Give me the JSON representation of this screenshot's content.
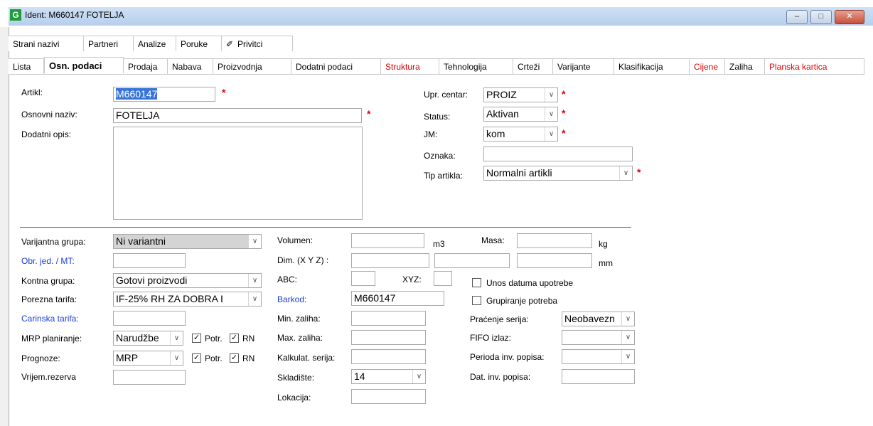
{
  "window": {
    "title": "Ident: M660147 FOTELJA",
    "app_icon": "G",
    "minimize": "–",
    "maximize": "□",
    "close": "✕"
  },
  "toptabs": [
    "Strani nazivi",
    "Partneri",
    "Analize",
    "Poruke",
    "Privitci"
  ],
  "tabs": [
    {
      "label": "Lista"
    },
    {
      "label": "Osn. podaci"
    },
    {
      "label": "Prodaja"
    },
    {
      "label": "Nabava"
    },
    {
      "label": "Proizvodnja"
    },
    {
      "label": "Dodatni podaci"
    },
    {
      "label": "Struktura"
    },
    {
      "label": "Tehnologija"
    },
    {
      "label": "Crteži"
    },
    {
      "label": "Varijante"
    },
    {
      "label": "Klasifikacija"
    },
    {
      "label": "Cijene"
    },
    {
      "label": "Zaliha"
    },
    {
      "label": "Planska kartica"
    }
  ],
  "top": {
    "artikl_label": "Artikl:",
    "artikl_value": "M660147",
    "naziv_label": "Osnovni naziv:",
    "naziv_value": "FOTELJA",
    "opis_label": "Dodatni opis:",
    "opis_value": "",
    "upr_label": "Upr. centar:",
    "upr_value": "PROIZ",
    "status_label": "Status:",
    "status_value": "Aktivan",
    "jm_label": "JM:",
    "jm_value": "kom",
    "oznaka_label": "Oznaka:",
    "oznaka_value": "",
    "tip_label": "Tip artikla:",
    "tip_value": "Normalni artikli",
    "required_mark": "*"
  },
  "left": {
    "varijantna_label": "Varijantna grupa:",
    "varijantna_value": "Ni variantni",
    "obr_label": "Obr. jed. / MT:",
    "obr_value": "",
    "kontna_label": "Kontna grupa:",
    "kontna_value": "Gotovi proizvodi",
    "porezna_label": "Porezna tarifa:",
    "porezna_value": "IF-25% RH ZA DOBRA I",
    "carinska_label": "Carinska tarifa:",
    "carinska_value": "",
    "mrp_label": "MRP planiranje:",
    "mrp_value": "Narudžbe",
    "prognoze_label": "Prognoze:",
    "prognoze_value": "MRP",
    "vrijem_label": "Vrijem.rezerva",
    "vrijem_value": "",
    "potr_label": "Potr.",
    "rn_label": "RN",
    "check": "✓"
  },
  "middle": {
    "volumen_label": "Volumen:",
    "volumen_value": "",
    "m3_label": "m3",
    "masa_label": "Masa:",
    "masa_value": "",
    "kg_label": "kg",
    "dim_label": "Dim. (X Y Z) :",
    "mm_label": "mm",
    "abc_label": "ABC:",
    "xyz_label": "XYZ:",
    "barkod_label": "Barkod:",
    "barkod_value": "M660147",
    "minz_label": "Min. zaliha:",
    "maxz_label": "Max. zaliha:",
    "kalk_label": "Kalkulat. serija:",
    "skladiste_label": "Skladište:",
    "skladiste_value": "14",
    "lokacija_label": "Lokacija:"
  },
  "right": {
    "unos_label": "Unos datuma upotrebe",
    "grup_label": "Grupiranje potreba",
    "pracenje_label": "Praćenje serija:",
    "pracenje_value": "Neobavezn",
    "fifo_label": "FIFO izlaz:",
    "fifo_value": "",
    "perioda_label": "Perioda inv. popisa:",
    "perioda_value": "",
    "dat_label": "Dat. inv. popisa:",
    "dat_value": ""
  },
  "icons": {
    "combo_arrow": "∨",
    "paperclip": "📎"
  }
}
